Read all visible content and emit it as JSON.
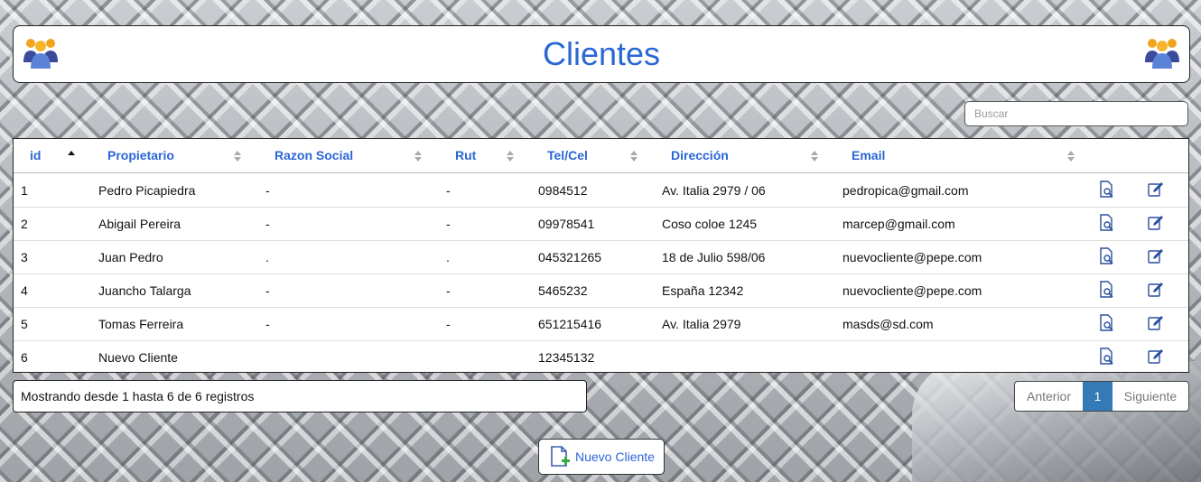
{
  "header": {
    "title": "Clientes",
    "icon_left": "users-group-icon",
    "icon_right": "users-group-icon"
  },
  "search": {
    "placeholder": "Buscar"
  },
  "table": {
    "columns": [
      "id",
      "Propietario",
      "Razon Social",
      "Rut",
      "Tel/Cel",
      "Dirección",
      "Email"
    ],
    "sorted_column": "id",
    "rows": [
      {
        "id": "1",
        "propietario": "Pedro Picapiedra",
        "razon": "-",
        "rut": "-",
        "tel": "0984512",
        "direccion": "Av. Italia 2979 / 06",
        "email": "pedropica@gmail.com"
      },
      {
        "id": "2",
        "propietario": "Abigail Pereira",
        "razon": "-",
        "rut": "-",
        "tel": "09978541",
        "direccion": "Coso coloe 1245",
        "email": "marcep@gmail.com"
      },
      {
        "id": "3",
        "propietario": "Juan Pedro",
        "razon": ".",
        "rut": ".",
        "tel": "045321265",
        "direccion": "18 de Julio 598/06",
        "email": "nuevocliente@pepe.com"
      },
      {
        "id": "4",
        "propietario": "Juancho Talarga",
        "razon": "-",
        "rut": "-",
        "tel": "5465232",
        "direccion": "España 12342",
        "email": "nuevocliente@pepe.com"
      },
      {
        "id": "5",
        "propietario": "Tomas Ferreira",
        "razon": "-",
        "rut": "-",
        "tel": "651215416",
        "direccion": "Av. Italia 2979",
        "email": "masds@sd.com"
      },
      {
        "id": "6",
        "propietario": "Nuevo Cliente",
        "razon": "",
        "rut": "",
        "tel": "12345132",
        "direccion": "",
        "email": ""
      }
    ],
    "row_actions": [
      "view-document-icon",
      "edit-icon"
    ]
  },
  "info": {
    "text": "Mostrando desde 1 hasta 6 de 6 registros"
  },
  "pagination": {
    "prev": "Anterior",
    "current": "1",
    "next": "Siguiente"
  },
  "new_client_button": {
    "label": "Nuevo Cliente",
    "icon": "add-document-icon"
  },
  "colors": {
    "accent": "#2a66d6",
    "page_active": "#337ab7"
  }
}
